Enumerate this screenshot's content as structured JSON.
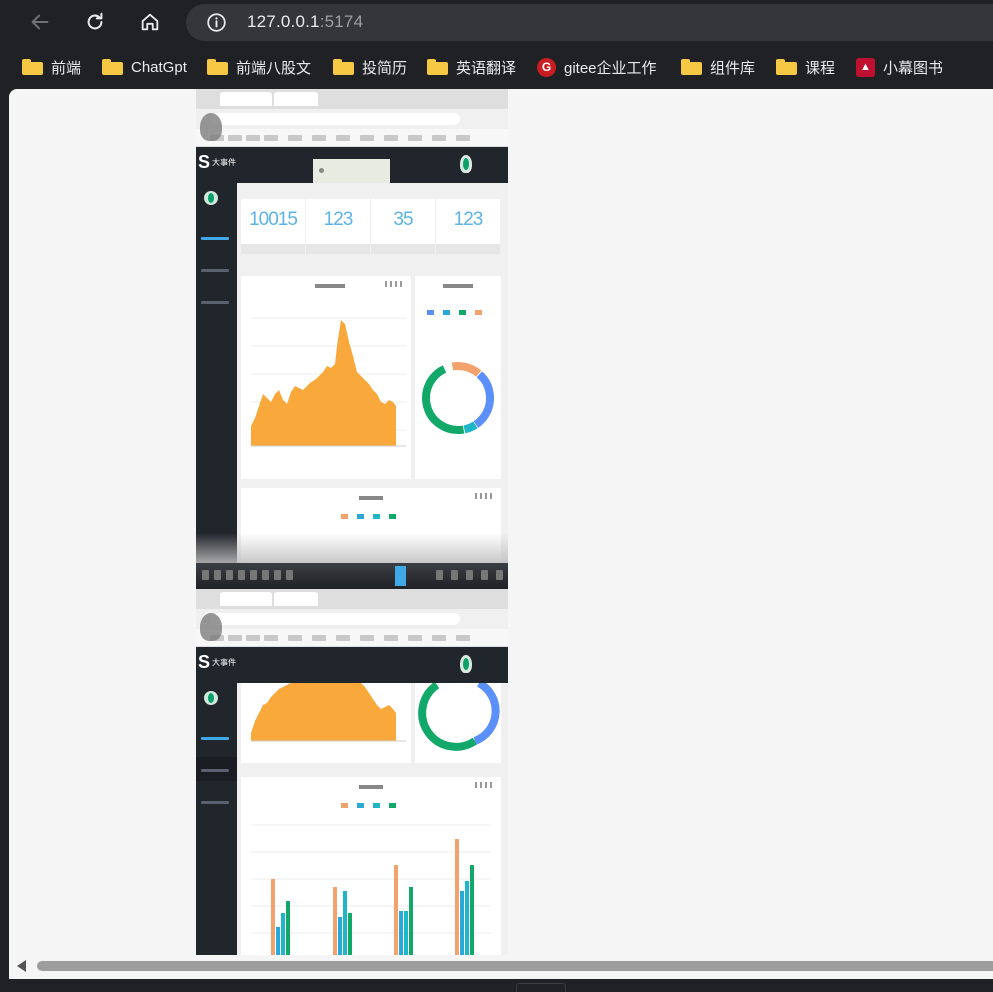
{
  "browser": {
    "url_host": "127.0.0.1",
    "url_port": ":5174",
    "bookmarks": [
      {
        "label": "前端",
        "icon": "folder-icon"
      },
      {
        "label": "ChatGpt",
        "icon": "folder-icon"
      },
      {
        "label": "前端八股文",
        "icon": "folder-icon"
      },
      {
        "label": "投简历",
        "icon": "folder-icon"
      },
      {
        "label": "英语翻译",
        "icon": "folder-icon"
      },
      {
        "label": "gitee企业工作",
        "icon": "gitee-icon"
      },
      {
        "label": "组件库",
        "icon": "folder-icon"
      },
      {
        "label": "课程",
        "icon": "folder-icon"
      },
      {
        "label": "小幕图书",
        "icon": "muke-icon"
      }
    ]
  },
  "dashboard": {
    "logo_mark": "S",
    "logo_name": "大事件",
    "stats": [
      {
        "value": "10015"
      },
      {
        "value": "123"
      },
      {
        "value": "35"
      },
      {
        "value": "123"
      }
    ],
    "colors": {
      "header": "#21252c",
      "accent_blue": "#5cb3e6",
      "area_orange": "#f9a93b",
      "series": [
        "#f4a26b",
        "#2aa8d8",
        "#1fb6c9",
        "#12a86a"
      ]
    }
  }
}
